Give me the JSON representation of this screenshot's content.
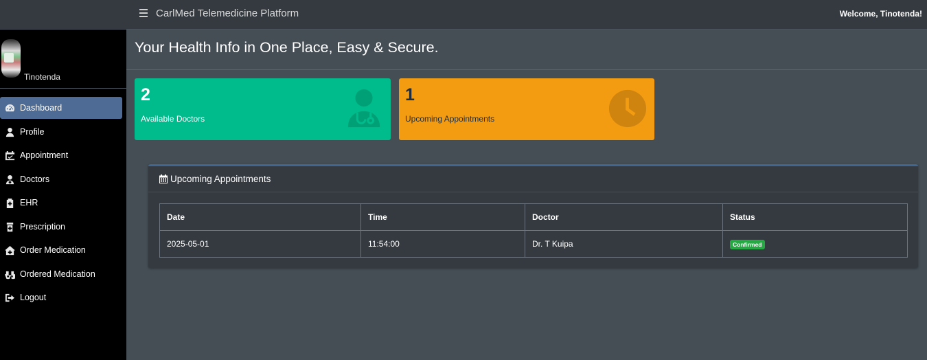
{
  "header": {
    "title": "CarlMed Telemedicine Platform",
    "welcome": "Welcome, Tinotenda!"
  },
  "sidebar": {
    "user_name": "Tinotenda",
    "items": [
      {
        "label": "Dashboard",
        "icon": "tachometer-icon",
        "active": true
      },
      {
        "label": "Profile",
        "icon": "user-icon"
      },
      {
        "label": "Appointment",
        "icon": "calendar-check-icon"
      },
      {
        "label": "Doctors",
        "icon": "user-md-icon"
      },
      {
        "label": "EHR",
        "icon": "file-medical-icon"
      },
      {
        "label": "Prescription",
        "icon": "prescription-bottle-icon"
      },
      {
        "label": "Order Medication",
        "icon": "clinic-house-icon"
      },
      {
        "label": "Ordered Medication",
        "icon": "binoculars-icon"
      },
      {
        "label": "Logout",
        "icon": "sign-out-icon"
      }
    ]
  },
  "page": {
    "title": "Your Health Info in One Place, Easy & Secure."
  },
  "stats": {
    "doctors": {
      "count": "2",
      "label": "Available Doctors",
      "color": "#00bc8c",
      "icon": "user-md-icon"
    },
    "appointments": {
      "count": "1",
      "label": "Upcoming Appointments",
      "color": "#f39c12",
      "icon": "clock-icon"
    }
  },
  "appointments_card": {
    "title": "Upcoming Appointments",
    "icon": "calendar-icon",
    "columns": [
      "Date",
      "Time",
      "Doctor",
      "Status"
    ],
    "rows": [
      {
        "date": "2025-05-01",
        "time": "11:54:00",
        "doctor": "Dr. T Kuipa",
        "status": "Confirmed",
        "status_color": "#28a745"
      }
    ]
  }
}
